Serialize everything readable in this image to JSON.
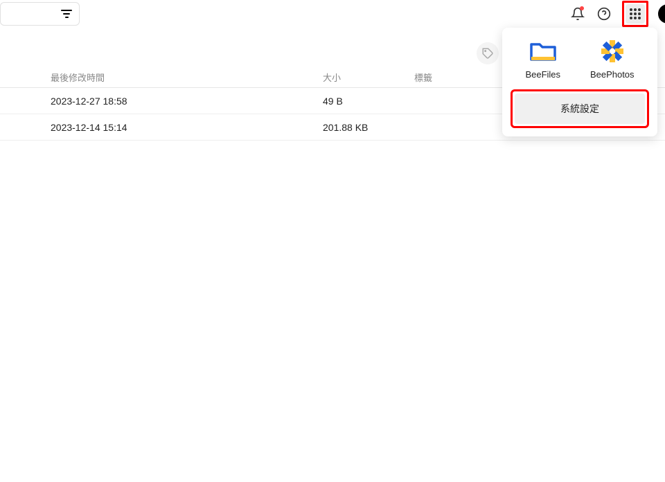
{
  "toolbar": {
    "filter_icon": "filter-icon",
    "notification_icon": "notification-icon",
    "help_icon": "help-icon",
    "apps_icon": "apps-icon",
    "avatar": "avatar"
  },
  "table": {
    "headers": {
      "modified": "最後修改時間",
      "size": "大小",
      "tags": "標籤"
    },
    "rows": [
      {
        "modified": "2023-12-27 18:58",
        "size": "49 B",
        "tags": ""
      },
      {
        "modified": "2023-12-14 15:14",
        "size": "201.88 KB",
        "tags": ""
      }
    ]
  },
  "tag_button": {
    "icon": "tag-icon"
  },
  "apps_popover": {
    "apps": [
      {
        "name": "BeeFiles",
        "label": "BeeFiles"
      },
      {
        "name": "BeePhotos",
        "label": "BeePhotos"
      }
    ],
    "settings_label": "系統設定"
  }
}
